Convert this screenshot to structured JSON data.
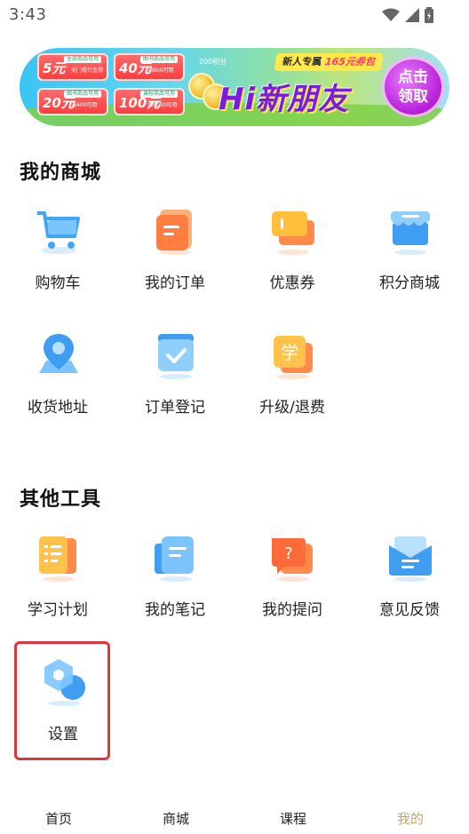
{
  "status_bar": {
    "time": "3:43",
    "icons": [
      "wifi-icon",
      "signal-icon",
      "battery-icon"
    ]
  },
  "banner": {
    "coupons": [
      {
        "amount": "5元",
        "tag": "全部商品可用",
        "desc": "无门槛代金券"
      },
      {
        "amount": "40元",
        "tag": "图书商品可用",
        "desc": "满800可用"
      },
      {
        "amount": "20元",
        "tag": "图书商品可用",
        "desc": "满400可用"
      },
      {
        "amount": "100元",
        "tag": "课程商品可用",
        "desc": "满4000可用"
      }
    ],
    "points": "200积分",
    "ribbon_prefix": "新人专属",
    "ribbon_amount": "165元券包",
    "headline": "Hi新朋友",
    "cta": "点击领取"
  },
  "sections": [
    {
      "title": "我的商城"
    },
    {
      "title": "其他工具"
    }
  ],
  "mall_items": [
    {
      "label": "购物车",
      "icon": "shopping-cart-icon"
    },
    {
      "label": "我的订单",
      "icon": "order-list-icon"
    },
    {
      "label": "优惠券",
      "icon": "coupon-icon"
    },
    {
      "label": "积分商城",
      "icon": "points-store-icon"
    },
    {
      "label": "收货地址",
      "icon": "location-pin-icon"
    },
    {
      "label": "订单登记",
      "icon": "order-register-icon"
    },
    {
      "label": "升级/退费",
      "icon": "upgrade-refund-icon"
    }
  ],
  "tool_items": [
    {
      "label": "学习计划",
      "icon": "study-plan-icon"
    },
    {
      "label": "我的笔记",
      "icon": "notes-icon"
    },
    {
      "label": "我的提问",
      "icon": "question-icon"
    },
    {
      "label": "意见反馈",
      "icon": "feedback-icon"
    },
    {
      "label": "设置",
      "icon": "settings-icon"
    }
  ],
  "bottom_nav": [
    {
      "label": "首页",
      "active": false
    },
    {
      "label": "商城",
      "active": false
    },
    {
      "label": "课程",
      "active": false
    },
    {
      "label": "我的",
      "active": true
    }
  ],
  "colors": {
    "active_nav": "#c9a463",
    "highlight_border": "#e0353a"
  }
}
